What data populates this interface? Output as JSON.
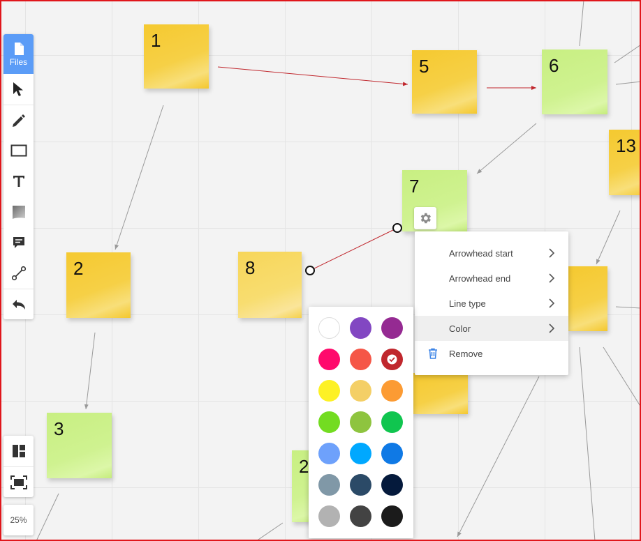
{
  "toolbar": {
    "files_label": "Files",
    "tools": [
      {
        "name": "select-tool",
        "icon": "cursor-arrow-icon"
      },
      {
        "name": "pen-tool",
        "icon": "pencil-icon"
      },
      {
        "name": "rectangle-tool",
        "icon": "rectangle-icon"
      },
      {
        "name": "text-tool",
        "icon": "text-icon"
      },
      {
        "name": "sticky-note-tool",
        "icon": "sticky-note-icon"
      },
      {
        "name": "comment-tool",
        "icon": "comment-icon"
      },
      {
        "name": "connector-tool",
        "icon": "connector-icon"
      },
      {
        "name": "undo-tool",
        "icon": "undo-icon"
      }
    ]
  },
  "view_tools": {
    "panels_icon": "layout-panels-icon",
    "fit_icon": "fit-to-screen-icon"
  },
  "zoom": {
    "label": "25%"
  },
  "notes": [
    {
      "id": "note-1",
      "label": "1",
      "color": "yellow"
    },
    {
      "id": "note-2",
      "label": "2",
      "color": "yellow"
    },
    {
      "id": "note-3",
      "label": "3",
      "color": "green"
    },
    {
      "id": "note-5",
      "label": "5",
      "color": "yellow"
    },
    {
      "id": "note-6",
      "label": "6",
      "color": "green"
    },
    {
      "id": "note-7",
      "label": "7",
      "color": "green"
    },
    {
      "id": "note-8",
      "label": "8",
      "color": "yellow"
    },
    {
      "id": "note-13",
      "label": "13",
      "color": "yellow"
    },
    {
      "id": "note-bottom",
      "label": "2",
      "color": "green"
    }
  ],
  "context_menu": {
    "items": [
      {
        "label": "Arrowhead start",
        "has_submenu": true
      },
      {
        "label": "Arrowhead end",
        "has_submenu": true
      },
      {
        "label": "Line type",
        "has_submenu": true
      },
      {
        "label": "Color",
        "has_submenu": true,
        "active": true
      },
      {
        "label": "Remove",
        "icon": "trash-icon"
      }
    ]
  },
  "color_palette": {
    "selected": "#c0272d",
    "rows": [
      [
        "#ffffff",
        "#8247c2",
        "#952a92"
      ],
      [
        "#ff0a6c",
        "#f55647",
        "#c0272d"
      ],
      [
        "#fdf125",
        "#f4cf66",
        "#fc9b33"
      ],
      [
        "#73dc21",
        "#8ec43f",
        "#10c54f"
      ],
      [
        "#6ea1fb",
        "#00a8ff",
        "#0f79e5"
      ],
      [
        "#8098a7",
        "#2b4a67",
        "#051a3c"
      ],
      [
        "#b2b2b2",
        "#434343",
        "#1b1b1b"
      ]
    ]
  },
  "colors": {
    "accent": "#5b9cf7",
    "connector_selected": "#c0272d",
    "connector_default": "#999999",
    "frame": "#e0161b"
  }
}
